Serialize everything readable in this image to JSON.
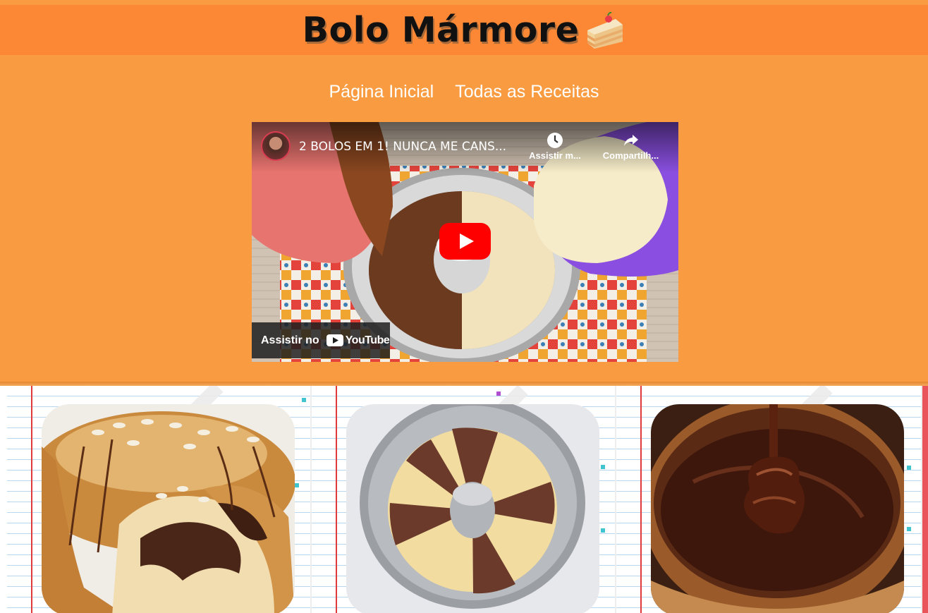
{
  "header": {
    "title": "Bolo Mármore",
    "icon": "cake-icon"
  },
  "nav": {
    "items": [
      {
        "label": "Página Inicial"
      },
      {
        "label": "Todas as Receitas"
      }
    ]
  },
  "video": {
    "title": "2 BOLOS EM 1! NUNCA ME CANS...",
    "watch_later_label": "Assistir m...",
    "share_label": "Compartilh...",
    "watch_on_label": "Assistir no",
    "platform_label": "YouTube"
  },
  "cards": [
    {
      "image": "marble-bundt-cake-with-almonds"
    },
    {
      "image": "marble-cake-batter-in-pan"
    },
    {
      "image": "chocolate-sauce-pour"
    }
  ],
  "colors": {
    "page_bg": "#f99c41",
    "header_bg": "#fc8836",
    "nav_text": "#ffffff"
  }
}
